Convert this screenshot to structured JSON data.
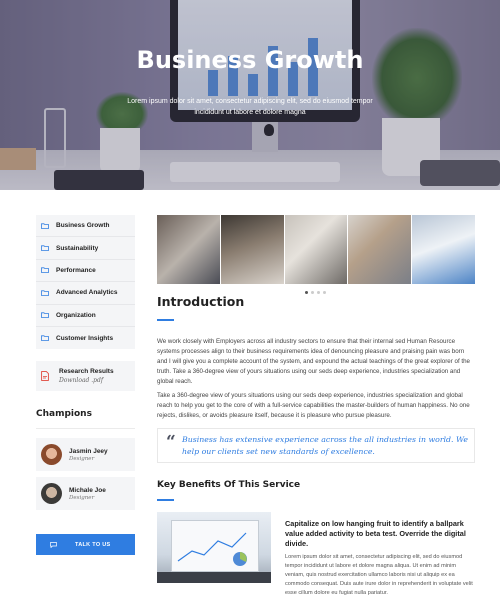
{
  "hero": {
    "title": "Business Growth",
    "subtitle": "Lorem ipsum dolor sit amet, consectetur adipiscing elit, sed do eiusmod tempor incididunt ut labore et dolore magna"
  },
  "sidebar": {
    "items": [
      {
        "label": "Business Growth",
        "icon": "folder-icon"
      },
      {
        "label": "Sustainability",
        "icon": "folder-icon"
      },
      {
        "label": "Performance",
        "icon": "folder-icon"
      },
      {
        "label": "Advanced Analytics",
        "icon": "folder-icon"
      },
      {
        "label": "Organization",
        "icon": "folder-icon"
      },
      {
        "label": "Customer Insights",
        "icon": "folder-icon"
      }
    ],
    "download": {
      "title": "Research Results",
      "subtitle": "Download .pdf",
      "icon": "pdf-icon"
    },
    "champions_title": "Champions",
    "champions": [
      {
        "name": "Jasmin Jeey",
        "role": "Designer"
      },
      {
        "name": "Michale Joe",
        "role": "Designer"
      }
    ],
    "talk_button": "TALK TO US"
  },
  "main": {
    "carousel_pages": 4,
    "carousel_active": 1,
    "intro_title": "Introduction",
    "intro_p1": "We work closely with Employers across all industry sectors to ensure that their internal sed Human Resource systems processes align to their business requirements idea of denouncing pleasure and praising pain was born and I will give you a complete account of the system, and expound the actual teachings of the great explorer of the truth. Take a 360-degree view of yours situations using our seds deep experience, industries specialization and global reach.",
    "intro_p2": "Take a 360-degree view of yours situations using our seds deep experience, industries specialization and global reach to help you get to the core of with a full-service capabilities the master-builders of human happiness. No one rejects, dislikes, or avoids pleasure itself, because it is pleasure who pursue pleasure.",
    "quote": "Business has extensive experience across the all industries in world. We help our clients set new standards of excellence.",
    "benefits_title": "Key Benefits Of This Service",
    "benefit_heading": "Capitalize on low hanging fruit to identify a ballpark value added activity to beta test. Override the digital divide.",
    "benefit_body": "Lorem ipsum dolor sit amet, consectetur adipiscing elit, sed do eiusmod tempor incididunt ut labore et dolore magna aliqua. Ut enim ad minim veniam, quis nostrud exercitation ullamco laboris nisi ut aliquip ex ea commodo consequat. Duis aute irure dolor in reprehenderit in voluptate velit esse cillum dolore eu fugiat nulla pariatur."
  },
  "colors": {
    "accent": "#2f7de1",
    "panel": "#f4f5f7"
  }
}
